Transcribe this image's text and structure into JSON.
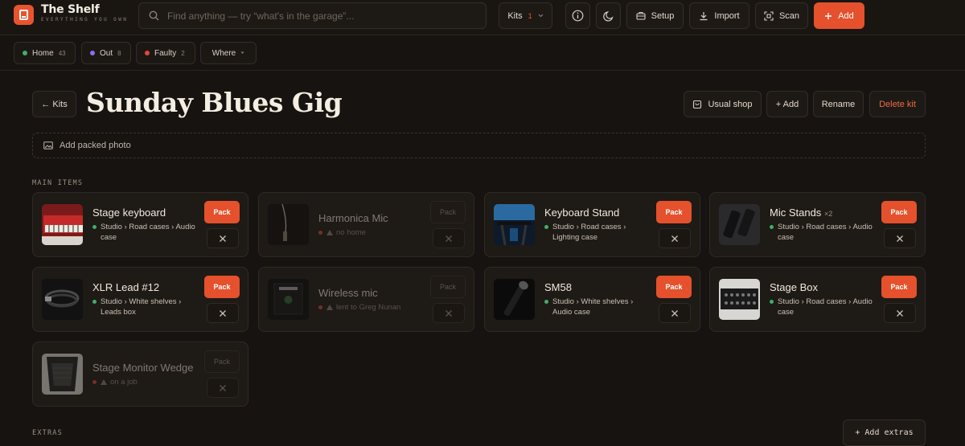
{
  "app": {
    "name": "The Shelf",
    "tagline": "EVERYTHING YOU OWN"
  },
  "search": {
    "placeholder": "Find anything — try “what's in the garage”..."
  },
  "toolbar": {
    "kits_label": "Kits",
    "kits_count": "1",
    "setup_label": "Setup",
    "import_label": "Import",
    "scan_label": "Scan",
    "add_label": "Add"
  },
  "filters": [
    {
      "label": "Home",
      "count": "43",
      "color": "#3fae6a"
    },
    {
      "label": "Out",
      "count": "8",
      "color": "#8b6ff0"
    },
    {
      "label": "Faulty",
      "count": "2",
      "color": "#e0483b"
    }
  ],
  "where_label": "Where",
  "kit": {
    "back_label": "← Kits",
    "title": "Sunday Blues Gig",
    "usual_shop_label": "Usual shop",
    "add_label": "+ Add",
    "rename_label": "Rename",
    "delete_label": "Delete kit",
    "photo_label": "Add packed photo"
  },
  "sections": {
    "main": "MAIN ITEMS",
    "extras": "EXTRAS"
  },
  "add_extras_label": "+ Add extras",
  "pack_label": "Pack",
  "items": [
    {
      "name": "Stage keyboard",
      "extra": "",
      "location": "Studio › Road cases › Audio case",
      "status": "home",
      "thumb": "keyboard"
    },
    {
      "name": "Harmonica Mic",
      "extra": "",
      "location": "no home",
      "status": "faulty",
      "thumb": "harmonica"
    },
    {
      "name": "Keyboard Stand",
      "extra": "",
      "location": "Studio › Road cases › Lighting case",
      "status": "home",
      "thumb": "stand"
    },
    {
      "name": "Mic Stands",
      "extra": "×2",
      "location": "Studio › Road cases › Audio case",
      "status": "home",
      "thumb": "micstands"
    },
    {
      "name": "XLR Lead #12",
      "extra": "",
      "location": "Studio › White shelves › Leads box",
      "status": "home",
      "thumb": "xlr"
    },
    {
      "name": "Wireless mic",
      "extra": "",
      "location": "lent to Greg Nunan",
      "status": "faulty",
      "thumb": "wireless"
    },
    {
      "name": "SM58",
      "extra": "",
      "location": "Studio › White shelves › Audio case",
      "status": "home",
      "thumb": "sm58"
    },
    {
      "name": "Stage Box",
      "extra": "",
      "location": "Studio › Road cases › Audio case",
      "status": "home",
      "thumb": "stagebox"
    },
    {
      "name": "Stage Monitor Wedge",
      "extra": "",
      "location": "on a job",
      "status": "faulty",
      "thumb": "wedge"
    }
  ],
  "colors": {
    "accent": "#e4512c",
    "home": "#3fae6a",
    "out": "#8b6ff0",
    "faulty": "#e0483b"
  }
}
